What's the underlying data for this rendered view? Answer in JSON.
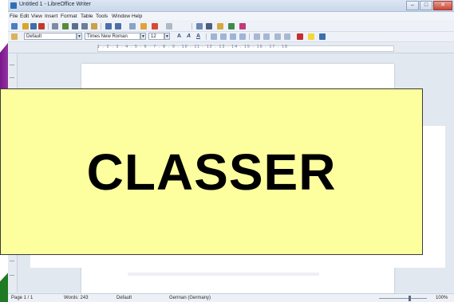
{
  "window": {
    "title": "Untitled 1 - LibreOffice Writer",
    "controls": [
      "–",
      "□",
      "✕"
    ]
  },
  "menu": [
    "File",
    "Edit",
    "View",
    "Insert",
    "Format",
    "Table",
    "Tools",
    "Window",
    "Help"
  ],
  "formatting": {
    "paragraph_style": "Default",
    "font_name": "Times New Roman",
    "font_size": "12"
  },
  "ruler": {
    "marks": "1 . 2 . 3 . 4 . 5 . 6 . 7 . 8 . 9 . 10 . 11 . 12 . 13 . 14 . 15 . 16 . 17 . 18"
  },
  "status": {
    "page": "Page 1 / 1",
    "words": "Words: 243",
    "style": "Default",
    "language": "German (Germany)",
    "zoom": "100%"
  },
  "overlay": {
    "label": "CLASSER"
  },
  "colors": {
    "overlay_bg": "#fdfe9e",
    "accent": "#2f6fb8"
  },
  "icons": [
    "new-icon",
    "open-icon",
    "save-icon",
    "pdf-icon",
    "print-icon",
    "spellcheck-icon",
    "cut-icon",
    "copy-icon",
    "paste-icon",
    "undo-icon",
    "redo-icon",
    "table-icon",
    "image-icon",
    "chart-icon",
    "bold-icon",
    "italic-icon",
    "underline-icon",
    "align-left-icon",
    "align-center-icon",
    "align-right-icon",
    "list-icon",
    "highlight-icon",
    "font-color-icon"
  ]
}
